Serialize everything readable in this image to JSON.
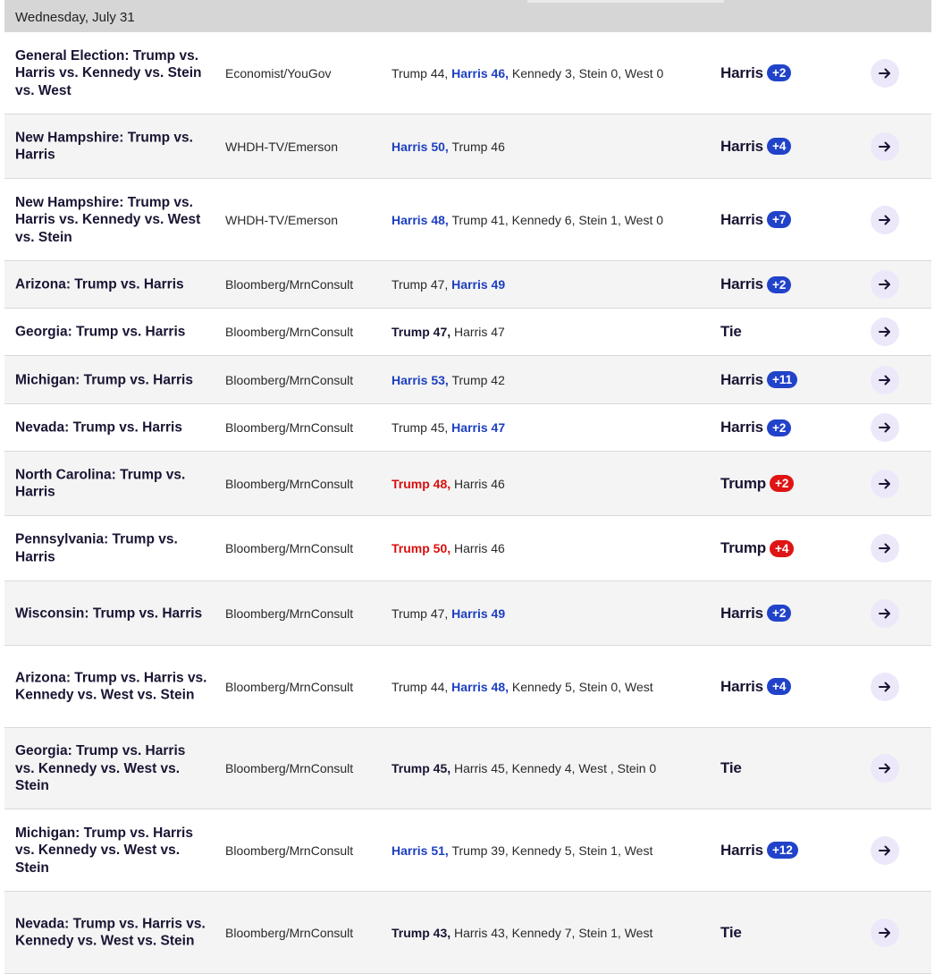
{
  "date_header": "Wednesday, July 31",
  "colors": {
    "democrat": "#1d3fbf",
    "republican": "#d90f0f",
    "arrow_bg": "#ece8fa"
  },
  "icons": {
    "row_link": "arrow-right-icon"
  },
  "polls": [
    {
      "race": "General Election: Trump vs. Harris vs. Kennedy vs. Stein vs. West",
      "pollster": "Economist/YouGov",
      "results": [
        {
          "text": "Trump 44, ",
          "bold": false,
          "party": ""
        },
        {
          "text": "Harris 46,",
          "bold": true,
          "party": "D"
        },
        {
          "text": " Kennedy 3, Stein 0, West 0",
          "bold": false,
          "party": ""
        }
      ],
      "spread_label": "Harris",
      "spread_value": "+2",
      "spread_party": "D"
    },
    {
      "race": "New Hampshire: Trump vs. Harris",
      "pollster": "WHDH-TV/Emerson",
      "results": [
        {
          "text": "Harris 50,",
          "bold": true,
          "party": "D"
        },
        {
          "text": " Trump 46",
          "bold": false,
          "party": ""
        }
      ],
      "spread_label": "Harris",
      "spread_value": "+4",
      "spread_party": "D"
    },
    {
      "race": "New Hampshire: Trump vs. Harris vs. Kennedy vs. West vs. Stein",
      "pollster": "WHDH-TV/Emerson",
      "results": [
        {
          "text": "Harris 48,",
          "bold": true,
          "party": "D"
        },
        {
          "text": " Trump 41, Kennedy 6, Stein 1, West 0",
          "bold": false,
          "party": ""
        }
      ],
      "spread_label": "Harris",
      "spread_value": "+7",
      "spread_party": "D"
    },
    {
      "race": "Arizona: Trump vs. Harris",
      "pollster": "Bloomberg/MrnConsult",
      "results": [
        {
          "text": "Trump 47, ",
          "bold": false,
          "party": ""
        },
        {
          "text": "Harris 49",
          "bold": true,
          "party": "D"
        }
      ],
      "spread_label": "Harris",
      "spread_value": "+2",
      "spread_party": "D"
    },
    {
      "race": "Georgia: Trump vs. Harris",
      "pollster": "Bloomberg/MrnConsult",
      "results": [
        {
          "text": "Trump 47,",
          "bold": true,
          "party": "N"
        },
        {
          "text": " Harris 47",
          "bold": false,
          "party": ""
        }
      ],
      "spread_label": "Tie",
      "spread_value": "",
      "spread_party": ""
    },
    {
      "race": "Michigan: Trump vs. Harris",
      "pollster": "Bloomberg/MrnConsult",
      "results": [
        {
          "text": "Harris 53,",
          "bold": true,
          "party": "D"
        },
        {
          "text": " Trump 42",
          "bold": false,
          "party": ""
        }
      ],
      "spread_label": "Harris",
      "spread_value": "+11",
      "spread_party": "D"
    },
    {
      "race": "Nevada: Trump vs. Harris",
      "pollster": "Bloomberg/MrnConsult",
      "results": [
        {
          "text": "Trump 45, ",
          "bold": false,
          "party": ""
        },
        {
          "text": "Harris 47",
          "bold": true,
          "party": "D"
        }
      ],
      "spread_label": "Harris",
      "spread_value": "+2",
      "spread_party": "D"
    },
    {
      "race": "North Carolina: Trump vs. Harris",
      "pollster": "Bloomberg/MrnConsult",
      "results": [
        {
          "text": "Trump 48,",
          "bold": true,
          "party": "R"
        },
        {
          "text": " Harris 46",
          "bold": false,
          "party": ""
        }
      ],
      "spread_label": "Trump",
      "spread_value": "+2",
      "spread_party": "R"
    },
    {
      "race": "Pennsylvania: Trump vs. Harris",
      "pollster": "Bloomberg/MrnConsult",
      "results": [
        {
          "text": "Trump 50,",
          "bold": true,
          "party": "R"
        },
        {
          "text": " Harris 46",
          "bold": false,
          "party": ""
        }
      ],
      "spread_label": "Trump",
      "spread_value": "+4",
      "spread_party": "R"
    },
    {
      "race": "Wisconsin: Trump vs. Harris",
      "pollster": "Bloomberg/MrnConsult",
      "results": [
        {
          "text": "Trump 47, ",
          "bold": false,
          "party": ""
        },
        {
          "text": "Harris 49",
          "bold": true,
          "party": "D"
        }
      ],
      "spread_label": "Harris",
      "spread_value": "+2",
      "spread_party": "D"
    },
    {
      "race": "Arizona: Trump vs. Harris vs. Kennedy vs. West vs. Stein",
      "pollster": "Bloomberg/MrnConsult",
      "results": [
        {
          "text": "Trump 44, ",
          "bold": false,
          "party": ""
        },
        {
          "text": "Harris 48,",
          "bold": true,
          "party": "D"
        },
        {
          "text": " Kennedy 5, Stein 0, West",
          "bold": false,
          "party": ""
        }
      ],
      "spread_label": "Harris",
      "spread_value": "+4",
      "spread_party": "D"
    },
    {
      "race": "Georgia: Trump vs. Harris vs. Kennedy vs. West vs. Stein",
      "pollster": "Bloomberg/MrnConsult",
      "results": [
        {
          "text": "Trump 45,",
          "bold": true,
          "party": "N"
        },
        {
          "text": " Harris 45, Kennedy 4, West , Stein 0",
          "bold": false,
          "party": ""
        }
      ],
      "spread_label": "Tie",
      "spread_value": "",
      "spread_party": ""
    },
    {
      "race": "Michigan: Trump vs. Harris vs. Kennedy vs. West vs. Stein",
      "pollster": "Bloomberg/MrnConsult",
      "results": [
        {
          "text": "Harris 51,",
          "bold": true,
          "party": "D"
        },
        {
          "text": " Trump 39, Kennedy 5, Stein 1, West",
          "bold": false,
          "party": ""
        }
      ],
      "spread_label": "Harris",
      "spread_value": "+12",
      "spread_party": "D"
    },
    {
      "race": "Nevada: Trump vs. Harris vs. Kennedy vs. West vs. Stein",
      "pollster": "Bloomberg/MrnConsult",
      "results": [
        {
          "text": "Trump 43,",
          "bold": true,
          "party": "N"
        },
        {
          "text": " Harris 43, Kennedy 7, Stein 1, West",
          "bold": false,
          "party": ""
        }
      ],
      "spread_label": "Tie",
      "spread_value": "",
      "spread_party": ""
    }
  ]
}
